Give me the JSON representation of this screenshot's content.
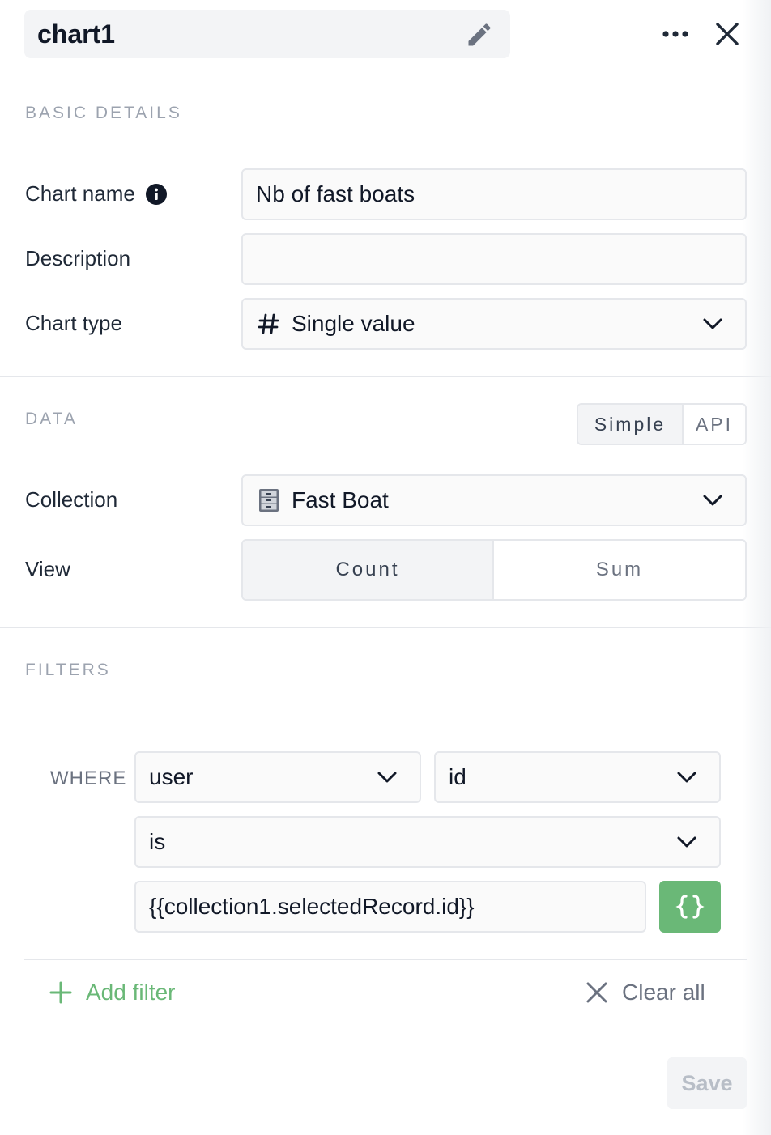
{
  "header": {
    "title": "chart1"
  },
  "basic_details": {
    "section_label": "BASIC DETAILS",
    "chart_name_label": "Chart name",
    "chart_name_value": "Nb of fast boats",
    "description_label": "Description",
    "description_value": "",
    "chart_type_label": "Chart type",
    "chart_type_value": "Single value"
  },
  "data_section": {
    "section_label": "DATA",
    "modes": [
      "Simple",
      "API"
    ],
    "selected_mode": "Simple",
    "collection_label": "Collection",
    "collection_value": "Fast Boat",
    "view_label": "View",
    "view_options": [
      "Count",
      "Sum"
    ],
    "selected_view": "Count"
  },
  "filters": {
    "section_label": "FILTERS",
    "where_label": "WHERE",
    "field_value": "user",
    "subfield_value": "id",
    "operator_value": "is",
    "value_input": "{{collection1.selectedRecord.id}}",
    "add_filter_label": "Add filter",
    "clear_all_label": "Clear all"
  },
  "footer": {
    "save_label": "Save"
  },
  "colors": {
    "accent_green": "#6ab877",
    "muted_text": "#9ca3af",
    "border": "#e5e7eb"
  },
  "icons": [
    "pencil-icon",
    "more-icon",
    "close-icon",
    "info-icon",
    "hash-icon",
    "cabinet-icon",
    "chevron-down-icon",
    "braces-icon",
    "plus-icon",
    "x-icon"
  ]
}
